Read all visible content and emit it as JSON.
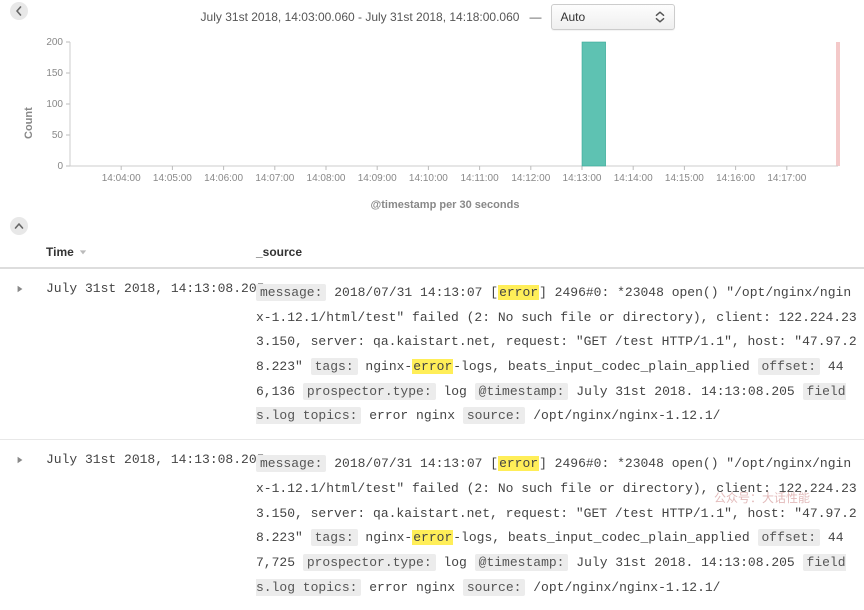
{
  "header": {
    "time_range": "July 31st 2018, 14:03:00.060 - July 31st 2018, 14:18:00.060",
    "separator": "—",
    "interval_selector": "Auto"
  },
  "chart_data": {
    "type": "bar",
    "title": "",
    "xlabel": "@timestamp per 30 seconds",
    "ylabel": "Count",
    "ylim": [
      0,
      200
    ],
    "yticks": [
      0,
      50,
      100,
      150,
      200
    ],
    "xticks": [
      "14:04:00",
      "14:05:00",
      "14:06:00",
      "14:07:00",
      "14:08:00",
      "14:09:00",
      "14:10:00",
      "14:11:00",
      "14:12:00",
      "14:13:00",
      "14:14:00",
      "14:15:00",
      "14:16:00",
      "14:17:00"
    ],
    "xrange": [
      "14:03:00",
      "14:18:00"
    ],
    "bar_color": "#5ec2b2",
    "categories": [
      "14:13:00"
    ],
    "values": [
      200
    ]
  },
  "columns": {
    "time": "Time",
    "source": "_source"
  },
  "rows": [
    {
      "time": "July 31st 2018, 14:13:08.205",
      "msg_pre": "2018/07/31 14:13:07 [",
      "msg_err": "error",
      "msg_post": "] 2496#0: *23048 open() \"/opt/nginx/nginx-1.12.1/html/test\" failed (2: No such file or directory), client: 122.224.233.150, server: qa.kaistart.net, request: \"GET /test HTTP/1.1\", host: \"47.97.28.223\"",
      "tags_pre": "nginx-",
      "tags_hl": "error",
      "tags_post": "-logs, beats_input_codec_plain_applied",
      "offset": "446,136",
      "prospector_type": "log",
      "timestamp": "July 31st 2018. 14:13:08.205",
      "fields_topics": "error nginx",
      "source_path": "/opt/nginx/nginx-1.12.1/"
    },
    {
      "time": "July 31st 2018, 14:13:08.205",
      "msg_pre": "2018/07/31 14:13:07 [",
      "msg_err": "error",
      "msg_post": "] 2496#0: *23048 open() \"/opt/nginx/nginx-1.12.1/html/test\" failed (2: No such file or directory), client: 122.224.233.150, server: qa.kaistart.net, request: \"GET /test HTTP/1.1\", host: \"47.97.28.223\"",
      "tags_pre": "nginx-",
      "tags_hl": "error",
      "tags_post": "-logs, beats_input_codec_plain_applied",
      "offset": "447,725",
      "prospector_type": "log",
      "timestamp": "July 31st 2018. 14:13:08.205",
      "fields_topics": "error nginx",
      "source_path": "/opt/nginx/nginx-1.12.1/"
    }
  ],
  "labels": {
    "message": "message:",
    "tags": "tags:",
    "offset": "offset:",
    "prospector_type": "prospector.type:",
    "at_timestamp": "@timestamp:",
    "fields_topics": "fields.log topics:",
    "source": "source:"
  },
  "watermark": "公众号：大话性能"
}
